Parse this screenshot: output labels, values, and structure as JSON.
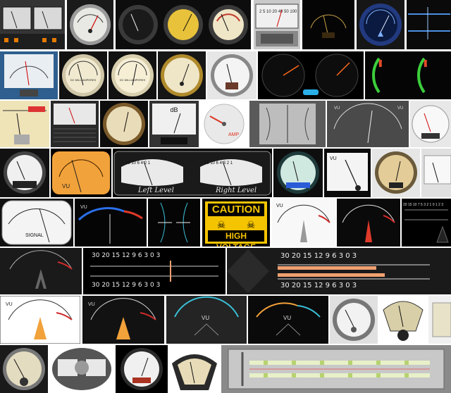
{
  "meter_labels": {
    "dc_milliamperes": "DC MILLIAMPERES",
    "dc_milliamperes_2": "DC MILLIAMPERES",
    "db": "dB",
    "amp": "AMP",
    "vu": "VU",
    "left_level": "Left Level",
    "right_level": "Right Level",
    "signal": "SIGNAL",
    "caution": "CAUTION",
    "high_voltage": "HIGH VOLTAGE"
  },
  "scales": {
    "vu_long": "30  20  15  12  9  6  3  0  3",
    "vu_long_ticks": [
      "30",
      "20",
      "15",
      "12",
      "9",
      "6",
      "3",
      "0",
      "3"
    ],
    "small_left": "15  10  6  4  2  1",
    "small_right": "15  10  6  4  3  2  1",
    "mini_scale": "20 15 10 7 5 3 2 1 0",
    "row5_small": "20 15 10 7 5 3 2 1 0 1 2 3"
  },
  "colors": {
    "amber": "#f2a23a",
    "orange_bar": "#f0a070",
    "caution_yellow": "#f5c400",
    "dark": "#0c0c0c",
    "cream": "#efe6c8"
  }
}
